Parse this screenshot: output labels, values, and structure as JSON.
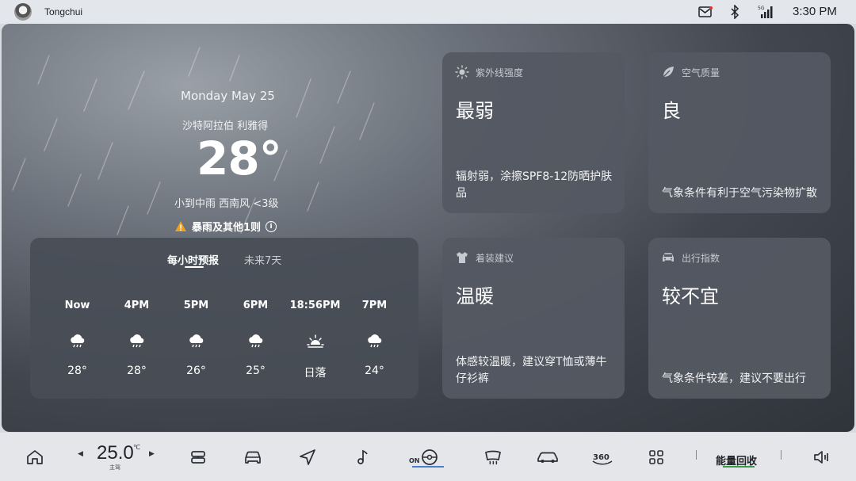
{
  "statusbar": {
    "username": "Tongchui",
    "network": "5G",
    "time": "3:30 PM",
    "icons": [
      "avatar",
      "message-icon",
      "bluetooth-icon",
      "signal-icon"
    ]
  },
  "weather": {
    "date": "Monday May 25",
    "city": "沙特阿拉伯 利雅得",
    "temperature": "28°",
    "condition": "小到中雨  西南风 <3级",
    "alert": "暴雨及其他1则"
  },
  "forecast": {
    "tabs": [
      {
        "label": "每小时预报",
        "active": true
      },
      {
        "label": "未来7天",
        "active": false
      }
    ],
    "hours": [
      {
        "time": "Now",
        "icon": "rain-cloud-icon",
        "temp": "28°"
      },
      {
        "time": "4PM",
        "icon": "rain-cloud-icon",
        "temp": "28°"
      },
      {
        "time": "5PM",
        "icon": "rain-cloud-icon",
        "temp": "26°"
      },
      {
        "time": "6PM",
        "icon": "rain-cloud-icon",
        "temp": "25°"
      },
      {
        "time": "18:56PM",
        "icon": "sunset-icon",
        "temp": "日落"
      },
      {
        "time": "7PM",
        "icon": "rain-cloud-icon",
        "temp": "24°"
      }
    ]
  },
  "cards": {
    "uv": {
      "title": "紫外线强度",
      "value": "最弱",
      "desc": "辐射弱，涂擦SPF8-12防晒护肤品",
      "icon": "sun-icon"
    },
    "air": {
      "title": "空气质量",
      "value": "良",
      "desc": "气象条件有利于空气污染物扩散",
      "icon": "leaf-icon"
    },
    "clothing": {
      "title": "着装建议",
      "value": "温暖",
      "desc": "体感较温暖，建议穿T恤或薄牛仔衫裤",
      "icon": "shirt-icon"
    },
    "travel": {
      "title": "出行指数",
      "value": "较不宜",
      "desc": "气象条件较差，建议不要出行",
      "icon": "car-icon"
    }
  },
  "dock": {
    "ac_temp": "25.0",
    "ac_unit": "℃",
    "ac_zone": "主驾",
    "on_label": "ON",
    "energy_label": "能量回收",
    "icons": [
      "home-icon",
      "seat-control-icon",
      "car-icon",
      "navigation-icon",
      "music-icon",
      "steering-assist-icon",
      "defrost-icon",
      "vehicle-view-icon",
      "360-camera-icon",
      "apps-grid-icon",
      "volume-icon"
    ]
  },
  "colors": {
    "accent_green": "#3a9d4a",
    "alert_orange": "#f0a020"
  }
}
